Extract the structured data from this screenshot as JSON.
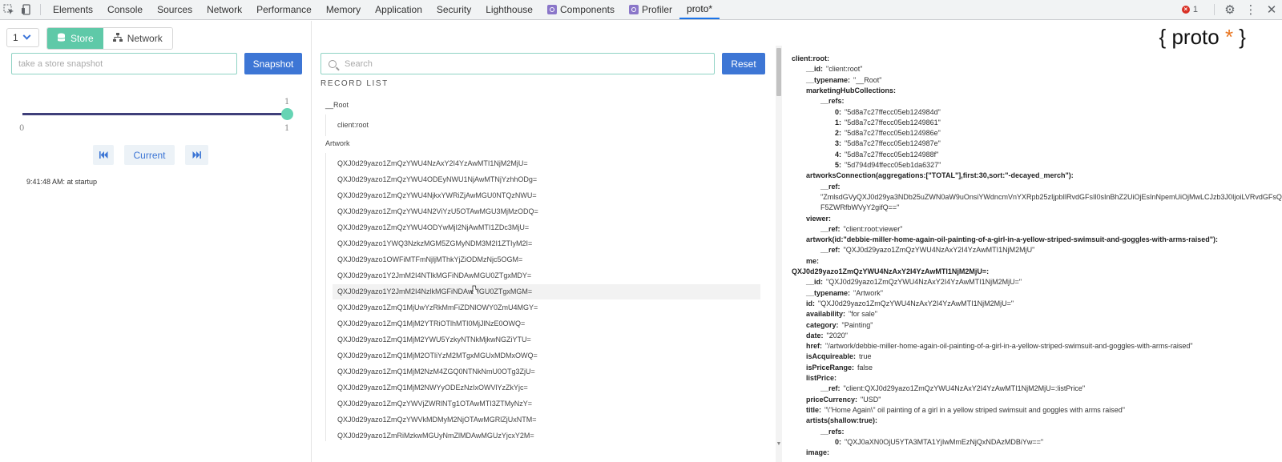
{
  "tabbar": {
    "tabs": [
      "Elements",
      "Console",
      "Sources",
      "Network",
      "Performance",
      "Memory",
      "Application",
      "Security",
      "Lighthouse",
      "Components",
      "Profiler",
      "proto*"
    ],
    "error_count": "1"
  },
  "left": {
    "version": "1",
    "seg_store": "Store",
    "seg_network": "Network",
    "snapshot_placeholder": "take a store snapshot",
    "snapshot_button": "Snapshot",
    "slider": {
      "min_label": "0",
      "max_label": "1",
      "value_label": "1",
      "right_label": "1",
      "value": 1,
      "max": 1
    },
    "current_button": "Current",
    "history": [
      "9:41:48 AM: at startup"
    ]
  },
  "middle": {
    "search_placeholder": "Search",
    "reset_button": "Reset",
    "record_list_title": "RECORD LIST",
    "types": [
      {
        "name": "__Root",
        "items": [
          "client:root"
        ]
      },
      {
        "name": "Artwork",
        "items": [
          "QXJ0d29yazo1ZmQzYWU4NzAxY2I4YzAwMTI1NjM2MjU=",
          "QXJ0d29yazo1ZmQzYWU4ODEyNWU1NjAwMTNjYzhhODg=",
          "QXJ0d29yazo1ZmQzYWU4NjkxYWRiZjAwMGU0NTQzNWU=",
          "QXJ0d29yazo1ZmQzYWU4N2ViYzU5OTAwMGU3MjMzODQ=",
          "QXJ0d29yazo1ZmQzYWU4ODYwMjI2NjAwMTI1ZDc3MjU=",
          "QXJ0d29yazo1YWQ3NzkzMGM5ZGMyNDM3M2I1ZTIyM2I=",
          "QXJ0d29yazo1OWFiMTFmNjljMThkYjZiODMzNjc5OGM=",
          "QXJ0d29yazo1Y2JmM2I4NTlkMGFiNDAwMGU0ZTgxMDY=",
          "QXJ0d29yazo1Y2JmM2I4NzlkMGFiNDAwMGU0ZTgxMGM=",
          "QXJ0d29yazo1ZmQ1MjUwYzRkMmFiZDNlOWY0ZmU4MGY=",
          "QXJ0d29yazo1ZmQ1MjM2YTRiOTlhMTI0MjJlNzE0OWQ=",
          "QXJ0d29yazo1ZmQ1MjM2YWU5YzkyNTNkMjkwNGZiYTU=",
          "QXJ0d29yazo1ZmQ1MjM2OTliYzM2MTgxMGUxMDMxOWQ=",
          "QXJ0d29yazo1ZmQ1MjM2NzM4ZGQ0NTNkNmU0OTg3ZjU=",
          "QXJ0d29yazo1ZmQ1MjM2NWYyODEzNzIxOWVlYzZkYjc=",
          "QXJ0d29yazo1ZmQzYWVjZWRlNTg1OTAwMTI3ZTMyNzY=",
          "QXJ0d29yazo1ZmQzYWVkMDMyM2NjOTAwMGRlZjUxNTM=",
          "QXJ0d29yazo1ZmRiMzkwMGUyNmZlMDAwMGUzYjcxY2M="
        ]
      }
    ],
    "hovered_index": 8
  },
  "right": {
    "logo_text": "{ proto ",
    "logo_star": "*",
    "logo_end": " }",
    "lines": [
      {
        "indent": 0,
        "key": "client:root:",
        "val": ""
      },
      {
        "indent": 1,
        "key": "__id:",
        "val": "\"client:root\""
      },
      {
        "indent": 1,
        "key": "__typename:",
        "val": "\"__Root\""
      },
      {
        "indent": 1,
        "key": "marketingHubCollections:",
        "val": ""
      },
      {
        "indent": 2,
        "key": "__refs:",
        "val": ""
      },
      {
        "indent": 3,
        "key": "0:",
        "val": "\"5d8a7c27ffecc05eb124984d\""
      },
      {
        "indent": 3,
        "key": "1:",
        "val": "\"5d8a7c27ffecc05eb1249861\""
      },
      {
        "indent": 3,
        "key": "2:",
        "val": "\"5d8a7c27ffecc05eb124986e\""
      },
      {
        "indent": 3,
        "key": "3:",
        "val": "\"5d8a7c27ffecc05eb124987e\""
      },
      {
        "indent": 3,
        "key": "4:",
        "val": "\"5d8a7c27ffecc05eb124988f\""
      },
      {
        "indent": 3,
        "key": "5:",
        "val": "\"5d794d94ffecc05eb1da6327\""
      },
      {
        "indent": 1,
        "key": "artworksConnection(aggregations:[\"TOTAL\"],first:30,sort:\"-decayed_merch\"):",
        "val": ""
      },
      {
        "indent": 2,
        "key": "__ref:",
        "val": ""
      },
      {
        "indent": 2,
        "key": "",
        "val": "\"ZmlsdGVyQXJ0d29ya3NDb25uZWN0aW9uOnsiYWdncmVnYXRpb25zIjpbIlRvdGFsIl0sInBhZ2UiOjEsInNpemUiOjMwLCJzb3J0IjoiLVRvdGFsQ29ubmVjdGlvbiJ9==\""
      },
      {
        "indent": 2,
        "key": "",
        "val": "F5ZWRfbWVyY2gifQ==\""
      },
      {
        "indent": 1,
        "key": "viewer:",
        "val": ""
      },
      {
        "indent": 2,
        "key": "__ref:",
        "val": "\"client:root:viewer\""
      },
      {
        "indent": 1,
        "key": "artwork(id:\"debbie-miller-home-again-oil-painting-of-a-girl-in-a-yellow-striped-swimsuit-and-goggles-with-arms-raised\"):",
        "val": ""
      },
      {
        "indent": 2,
        "key": "__ref:",
        "val": "\"QXJ0d29yazo1ZmQzYWU4NzAxY2I4YzAwMTI1NjM2MjU\""
      },
      {
        "indent": 1,
        "key": "me:",
        "val": ""
      },
      {
        "indent": 0,
        "key": "QXJ0d29yazo1ZmQzYWU4NzAxY2I4YzAwMTI1NjM2MjU=:",
        "val": ""
      },
      {
        "indent": 1,
        "key": "__id:",
        "val": "\"QXJ0d29yazo1ZmQzYWU4NzAxY2I4YzAwMTI1NjM2MjU=\""
      },
      {
        "indent": 1,
        "key": "__typename:",
        "val": "\"Artwork\""
      },
      {
        "indent": 1,
        "key": "id:",
        "val": "\"QXJ0d29yazo1ZmQzYWU4NzAxY2I4YzAwMTI1NjM2MjU=\""
      },
      {
        "indent": 1,
        "key": "availability:",
        "val": "\"for sale\""
      },
      {
        "indent": 1,
        "key": "category:",
        "val": "\"Painting\""
      },
      {
        "indent": 1,
        "key": "date:",
        "val": "\"2020\""
      },
      {
        "indent": 1,
        "key": "href:",
        "val": "\"/artwork/debbie-miller-home-again-oil-painting-of-a-girl-in-a-yellow-striped-swimsuit-and-goggles-with-arms-raised\""
      },
      {
        "indent": 1,
        "key": "isAcquireable:",
        "val": "true"
      },
      {
        "indent": 1,
        "key": "isPriceRange:",
        "val": "false"
      },
      {
        "indent": 1,
        "key": "listPrice:",
        "val": ""
      },
      {
        "indent": 2,
        "key": "__ref:",
        "val": "\"client:QXJ0d29yazo1ZmQzYWU4NzAxY2I4YzAwMTI1NjM2MjU=:listPrice\""
      },
      {
        "indent": 1,
        "key": "priceCurrency:",
        "val": "\"USD\""
      },
      {
        "indent": 1,
        "key": "title:",
        "val": "\"\\\"Home Again\\\" oil painting of a girl in a yellow striped swimsuit and goggles with arms raised\""
      },
      {
        "indent": 1,
        "key": "artists(shallow:true):",
        "val": ""
      },
      {
        "indent": 2,
        "key": "__refs:",
        "val": ""
      },
      {
        "indent": 3,
        "key": "0:",
        "val": "\"QXJ0aXN0OjU5YTA3MTA1YjIwMmEzNjQxNDAzMDBiYw==\""
      },
      {
        "indent": 1,
        "key": "image:",
        "val": ""
      }
    ]
  },
  "colors": {
    "accent_green": "#5fc9a8",
    "accent_blue": "#3d76d5",
    "slider_track": "#3f3f7a",
    "logo_star": "#e8741e"
  }
}
